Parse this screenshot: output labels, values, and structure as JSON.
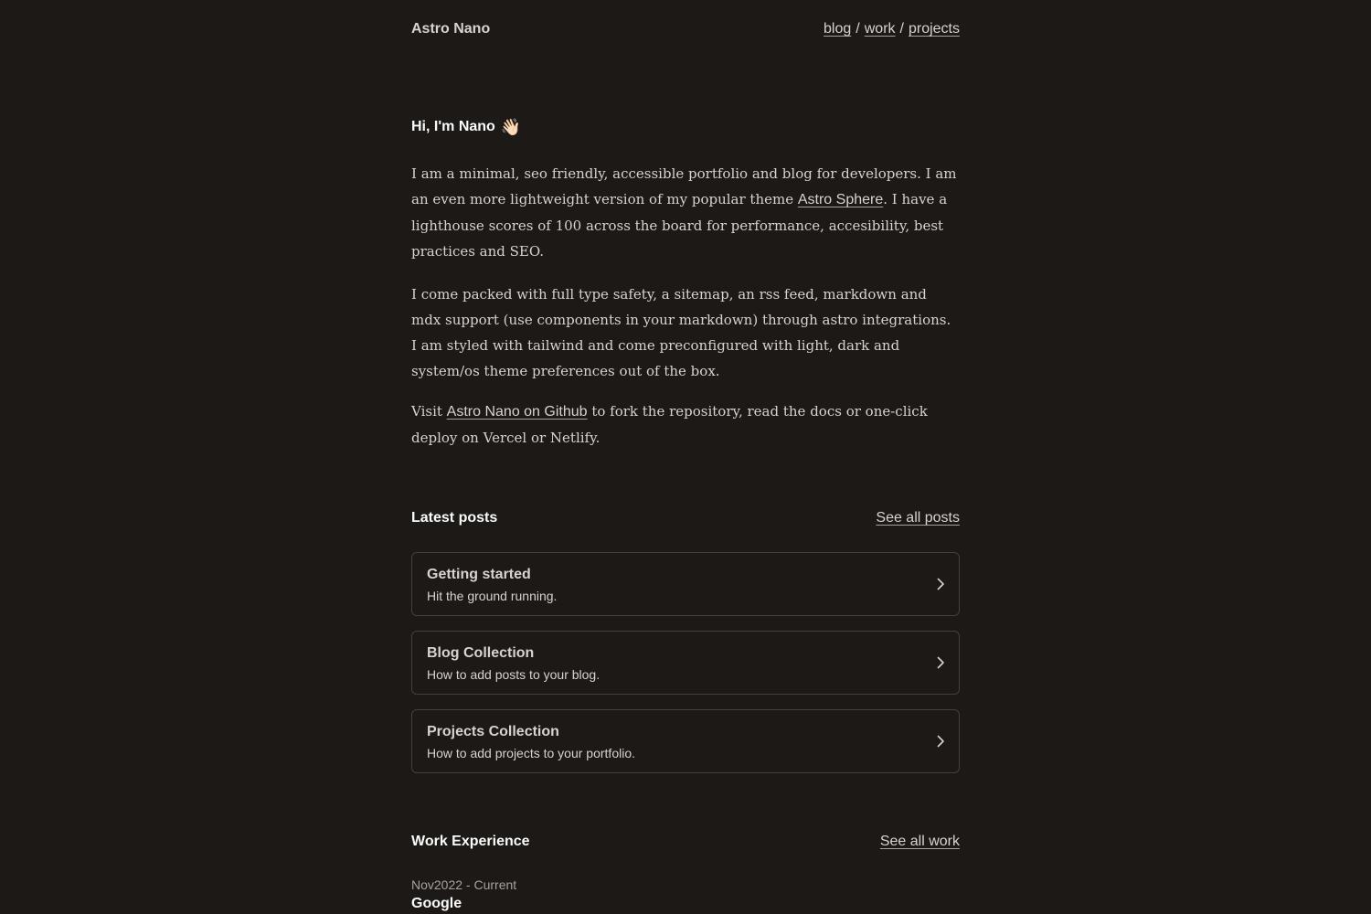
{
  "header": {
    "brand": "Astro Nano",
    "nav": [
      {
        "label": "blog"
      },
      {
        "label": "work"
      },
      {
        "label": "projects"
      }
    ],
    "separator": "/"
  },
  "intro": {
    "title": "Hi, I'm Nano",
    "emoji": "👋🏻",
    "p1_before": "I am a minimal, seo friendly, accessible portfolio and blog for developers. I am an even more lightweight version of my popular theme ",
    "p1_link": "Astro Sphere",
    "p1_after": ". I have a lighthouse scores of 100 across the board for performance, accesibility, best practices and SEO.",
    "p2": "I come packed with full type safety, a sitemap, an rss feed, markdown and mdx support (use components in your markdown) through astro integrations. I am styled with tailwind and come preconfigured with light, dark and system/os theme preferences out of the box.",
    "p3_before": "Visit ",
    "p3_link": "Astro Nano on Github",
    "p3_after": " to fork the repository, read the docs or one-click deploy on Vercel or Netlify."
  },
  "posts": {
    "title": "Latest posts",
    "see_all": "See all posts",
    "items": [
      {
        "title": "Getting started",
        "description": "Hit the ground running."
      },
      {
        "title": "Blog Collection",
        "description": "How to add posts to your blog."
      },
      {
        "title": "Projects Collection",
        "description": "How to add projects to your portfolio."
      }
    ]
  },
  "work": {
    "title": "Work Experience",
    "see_all": "See all work",
    "items": [
      {
        "date": "Nov2022 - Current",
        "company": "Google"
      }
    ]
  },
  "icons": {
    "card_arrow": "chevron-right-icon"
  },
  "colors": {
    "background": "#1c1917",
    "text": "#d6d3d1",
    "heading": "#fafaf9",
    "border": "#44403c"
  }
}
